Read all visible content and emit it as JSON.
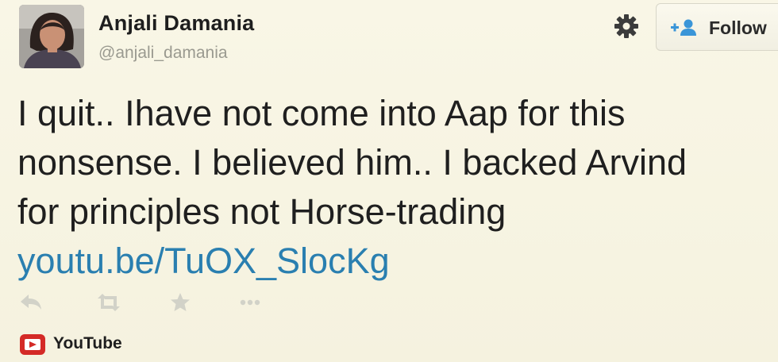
{
  "user": {
    "display_name": "Anjali Damania",
    "handle": "@anjali_damania"
  },
  "header": {
    "settings_icon": "gear-icon",
    "follow_icon": "add-user-icon",
    "follow_label": "Follow"
  },
  "tweet": {
    "lines": [
      "I quit.. Ihave not come into Aap for this",
      "nonsense. I believed him.. I backed Arvind",
      "for principles not Horse-trading"
    ],
    "link": "youtu.be/TuOX_SlocKg"
  },
  "actions": [
    "reply-icon",
    "retweet-icon",
    "favorite-icon",
    "more-icon"
  ],
  "card": {
    "source_icon": "youtube-icon",
    "source_label": "YouTube"
  },
  "colors": {
    "background": "#f7f4e3",
    "link": "#2a7fb0",
    "follow_accent": "#3a95d8",
    "youtube_red": "#d42a26",
    "muted_icon": "#d2d2c8"
  }
}
